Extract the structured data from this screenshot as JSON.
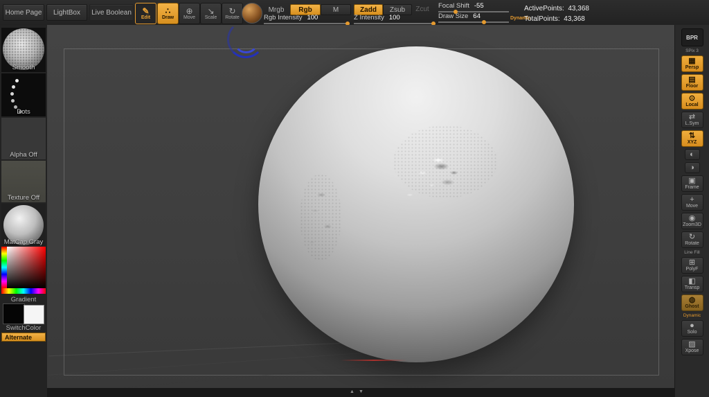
{
  "topbar": {
    "home_page": "Home Page",
    "lightbox": "LightBox",
    "live_boolean": "Live Boolean",
    "edit": "Edit",
    "draw": "Draw",
    "move": "Move",
    "scale": "Scale",
    "rotate": "Rotate",
    "mrgb": "Mrgb",
    "rgb": "Rgb",
    "m": "M",
    "zadd": "Zadd",
    "zsub": "Zsub",
    "zcut": "Zcut",
    "focal_shift_label": "Focal Shift",
    "focal_shift_value": "-55",
    "rgb_intensity_label": "Rgb Intensity",
    "rgb_intensity_value": "100",
    "z_intensity_label": "Z Intensity",
    "z_intensity_value": "100",
    "draw_size_label": "Draw Size",
    "draw_size_value": "64",
    "dynamic": "Dynamic",
    "active_points": "ActivePoints:  43,368",
    "total_points": "TotalPoints:  43,368"
  },
  "left_panel": {
    "brush_label": "Smooth",
    "stroke_label": "Dots",
    "alpha_label": "Alpha Off",
    "texture_label": "Texture Off",
    "material_label": "MatCap Gray",
    "gradient_label": "Gradient",
    "switchcolor_label": "SwitchColor",
    "alternate_label": "Alternate"
  },
  "right_panel": {
    "bpr": "BPR",
    "spix": "SPix 3",
    "persp": "Persp",
    "floor": "Floor",
    "local": "Local",
    "lsym": "L.Sym",
    "xyz": "XYZ",
    "frame": "Frame",
    "move": "Move",
    "zoom3d": "Zoom3D",
    "rotate": "Rotate",
    "line_fill": "Line Fill",
    "polyf": "PolyF",
    "transp": "Transp",
    "ghost": "Ghost",
    "dynamic": "Dynamic",
    "solo": "Solo",
    "xpose": "Xpose"
  },
  "icons": {
    "edit": "✎",
    "draw": "∴",
    "move": "⊕",
    "scale": "↘",
    "rotate": "↻",
    "persp": "▦",
    "floor": "▤",
    "local": "⊙",
    "lsym": "⇄",
    "xyz_axis": "⇅",
    "pan": "◐",
    "magnify": "◑",
    "frame": "▣",
    "move3d": "+",
    "zoom3d": "◉",
    "rotate3d": "↻",
    "polyf": "⊞",
    "transp": "◧",
    "ghost": "◍",
    "solo": "●",
    "xpose": "▨",
    "arrow_up": "▲",
    "arrow_down": "▼"
  },
  "colors": {
    "accent": "#e59a2f",
    "canvas_bg": "#3e3e3e"
  }
}
